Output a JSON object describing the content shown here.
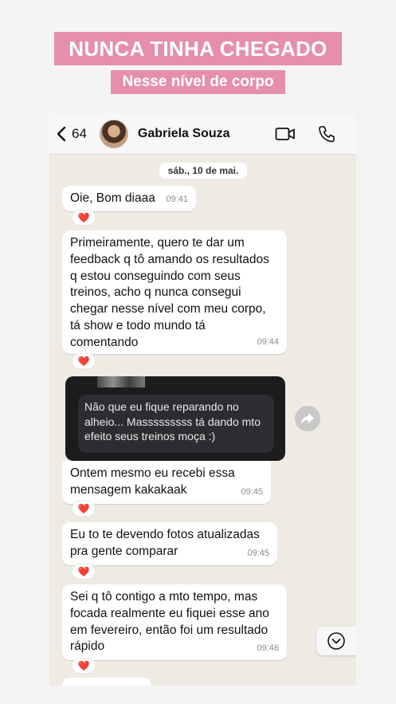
{
  "banner": {
    "title": "NUNCA TINHA CHEGADO",
    "subtitle": "Nesse nível de corpo"
  },
  "header": {
    "back_count": "64",
    "contact_name": "Gabriela Souza"
  },
  "date_label": "sáb., 10 de mai.",
  "messages": [
    {
      "text": "Oie, Bom diaaa",
      "time": "09:41",
      "reaction": "❤️"
    },
    {
      "text": "Primeiramente, quero te dar um feedback q tô amando os resultados q estou conseguindo com seus treinos, acho q nunca consegui chegar nesse nível com meu corpo, tá show e todo mundo tá comentando",
      "time": "09:44",
      "reaction": "❤️"
    },
    {
      "text": "Ontem mesmo eu recebi essa mensagem kakakaak",
      "time": "09:45",
      "reaction": "❤️"
    },
    {
      "text": "Eu to te devendo fotos atualizadas pra gente comparar",
      "time": "09:45",
      "reaction": "❤️"
    },
    {
      "text": "Sei q tô contigo a mto tempo, mas focada realmente eu fiquei esse ano em fevereiro, então foi um resultado rápido",
      "time": "09:46",
      "reaction": "❤️"
    }
  ],
  "screenshot_message": {
    "text": "Não que eu fique reparando no alheio... Masssssssss tá dando mto efeito seus treinos moça :)"
  },
  "icons": {
    "back": "chevron-left-icon",
    "video": "video-camera-icon",
    "call": "phone-icon",
    "forward": "forward-arrow-icon",
    "scroll": "chevron-down-circle-icon"
  },
  "colors": {
    "banner": "#e58fac",
    "chat_bg": "#efeae2",
    "bubble": "#ffffff",
    "heart": "#e0245e"
  }
}
